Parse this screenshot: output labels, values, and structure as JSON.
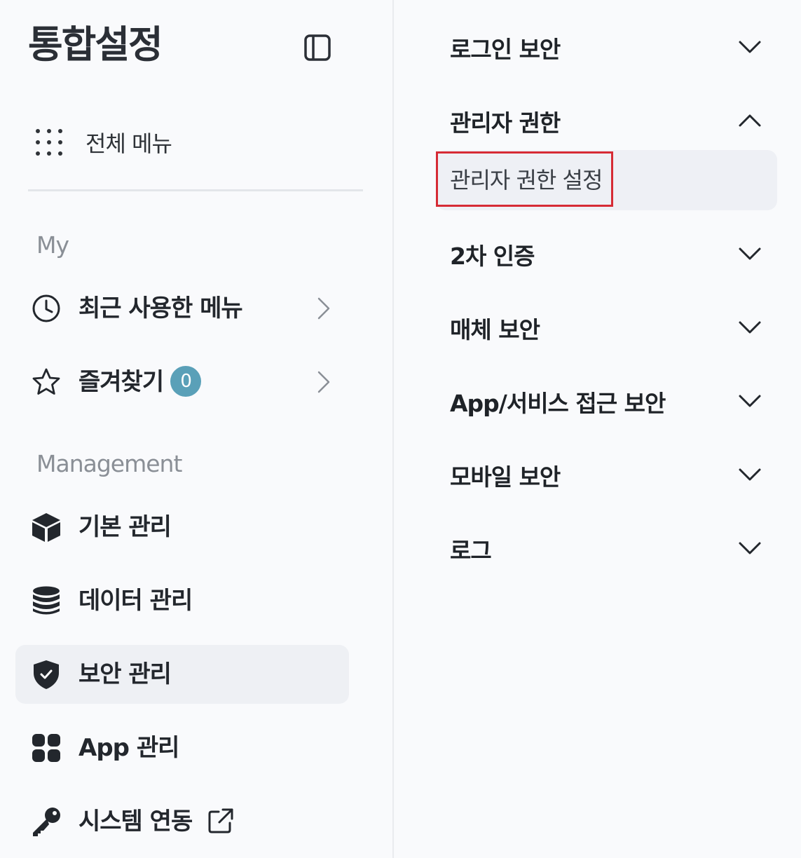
{
  "app": {
    "title": "통합설정"
  },
  "sidebar": {
    "all_menu_label": "전체 메뉴",
    "sections": {
      "my": "My",
      "management": "Management"
    },
    "my_items": [
      {
        "label": "최근 사용한 메뉴",
        "icon": "clock-icon"
      },
      {
        "label": "즐겨찾기",
        "icon": "star-icon",
        "badge": "0"
      }
    ],
    "management_items": [
      {
        "label": "기본 관리",
        "icon": "cube-icon"
      },
      {
        "label": "데이터 관리",
        "icon": "database-icon"
      },
      {
        "label": "보안 관리",
        "icon": "shield-check-icon",
        "active": true
      },
      {
        "label": "App 관리",
        "icon": "apps-grid-icon"
      },
      {
        "label": "시스템 연동",
        "icon": "key-icon",
        "external": true
      }
    ]
  },
  "submenu": {
    "groups": [
      {
        "label": "로그인 보안",
        "expanded": false
      },
      {
        "label": "관리자 권한",
        "expanded": true,
        "items": [
          {
            "label": "관리자 권한 설정",
            "selected": true
          }
        ]
      },
      {
        "label": "2차 인증",
        "expanded": false
      },
      {
        "label": "매체 보안",
        "expanded": false
      },
      {
        "label": "App/서비스 접근 보안",
        "expanded": false
      },
      {
        "label": "모바일 보안",
        "expanded": false
      },
      {
        "label": "로그",
        "expanded": false
      }
    ]
  },
  "colors": {
    "badge": "#5aa0b8",
    "highlight": "#d62b35",
    "active_bg": "#eef0f4",
    "page_bg": "#f9fafc"
  }
}
